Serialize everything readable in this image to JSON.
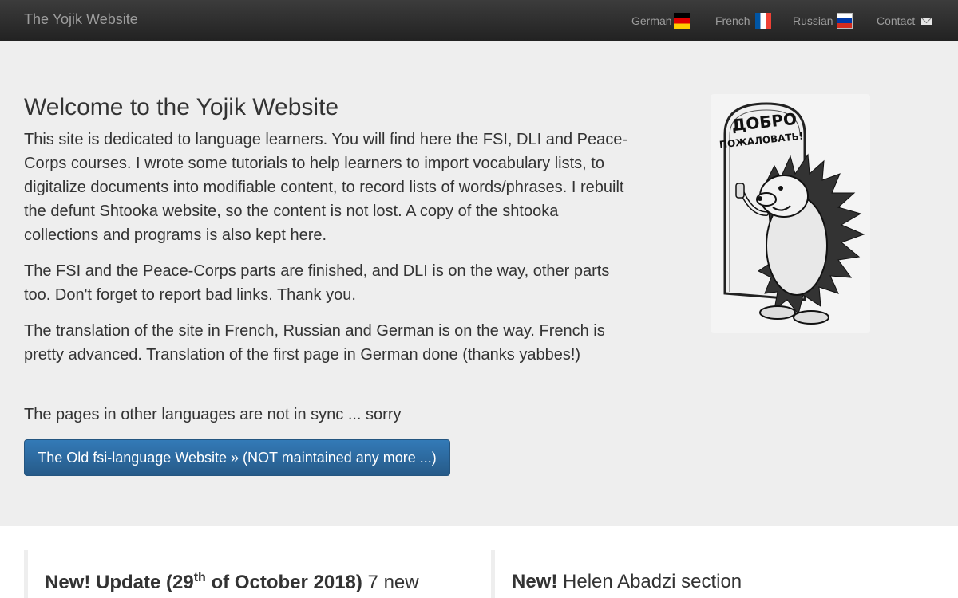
{
  "navbar": {
    "brand": "The Yojik Website",
    "links": [
      {
        "label": "German",
        "icon": "german-flag-icon"
      },
      {
        "label": "French",
        "icon": "french-flag-icon"
      },
      {
        "label": "Russian",
        "icon": "russian-flag-icon"
      },
      {
        "label": "Contact",
        "icon": "envelope-icon"
      }
    ]
  },
  "jumbotron": {
    "title": "Welcome to the Yojik Website",
    "paragraphs": [
      "This site is dedicated to language learners. You will find here the FSI, DLI and Peace-Corps courses. I wrote some tutorials to help learners to import vocabulary lists, to digitalize documents into modifiable content, to record lists of words/phrases. I rebuilt the defunt Shtooka website, so the content is not lost. A copy of the shtooka collections and programs is also kept here.",
      "The FSI and the Peace-Corps parts are finished, and DLI is on the way, other parts too. Don't forget to report bad links. Thank you.",
      "The translation of the site in French, Russian and German is on the way. French is pretty advanced. Translation of the first page in German done (thanks yabbes!)",
      "The pages in other languages are not in sync ... sorry"
    ],
    "button_label": "The Old fsi-language Website » (NOT maintained any more ...)",
    "illustration": {
      "sign_line1": "ДОБРО",
      "sign_line2": "ПОЖАЛОВАТЬ!"
    }
  },
  "panels": [
    {
      "new_label": "New!",
      "update_label": "Update (29",
      "superscript": "th",
      "date_rest": " of October 2018)",
      "rest": " 7 new"
    },
    {
      "new_label": "New!",
      "rest": " Helen Abadzi section"
    }
  ],
  "colors": {
    "navbar_bg": "#222222",
    "jumbotron_bg": "#eeeeee",
    "button_blue": "#337ab7"
  }
}
